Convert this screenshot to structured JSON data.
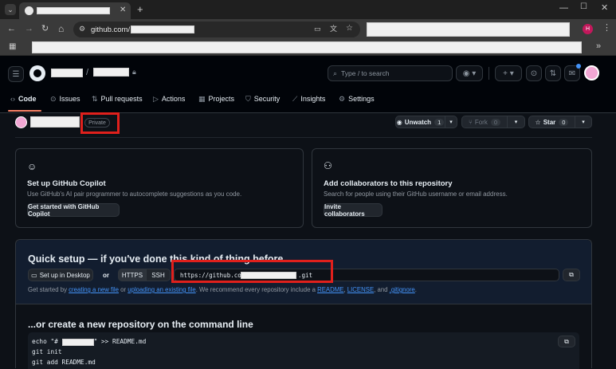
{
  "browser": {
    "url_prefix": "github.com/",
    "profile_initial": "H"
  },
  "header": {
    "search_placeholder": "Type / to search",
    "search_key": "/"
  },
  "nav": {
    "tabs": [
      {
        "label": "Code",
        "icon": "code-icon",
        "active": true
      },
      {
        "label": "Issues",
        "icon": "issue-icon"
      },
      {
        "label": "Pull requests",
        "icon": "pull-request-icon"
      },
      {
        "label": "Actions",
        "icon": "play-icon"
      },
      {
        "label": "Projects",
        "icon": "table-icon"
      },
      {
        "label": "Security",
        "icon": "shield-icon"
      },
      {
        "label": "Insights",
        "icon": "graph-icon"
      },
      {
        "label": "Settings",
        "icon": "gear-icon"
      }
    ]
  },
  "repo": {
    "visibility": "Private",
    "unwatch_label": "Unwatch",
    "watch_count": "1",
    "fork_label": "Fork",
    "fork_count": "0",
    "star_label": "Star",
    "star_count": "0"
  },
  "copilot_card": {
    "title": "Set up GitHub Copilot",
    "description": "Use GitHub's AI pair programmer to autocomplete suggestions as you code.",
    "button": "Get started with GitHub Copilot"
  },
  "collab_card": {
    "title": "Add collaborators to this repository",
    "description": "Search for people using their GitHub username or email address.",
    "button": "Invite collaborators"
  },
  "quick_setup": {
    "title": "Quick setup — if you've done this kind of thing before",
    "desktop_button": "Set up in Desktop",
    "or": "or",
    "https_label": "HTTPS",
    "ssh_label": "SSH",
    "url_start": "https://github.com/",
    "url_end": ".git",
    "help_prefix": "Get started by",
    "help_link1": "creating a new file",
    "help_or": "or",
    "help_link2": "uploading an existing file",
    "help_mid": ". We recommend every repository include a",
    "help_readme": "README",
    "help_comma": ",",
    "help_license": "LICENSE",
    "help_and": ", and",
    "help_gitignore": ".gitignore",
    "help_end": "."
  },
  "cli": {
    "title": "...or create a new repository on the command line",
    "line1_start": "echo \"#",
    "line1_end": "\" >> README.md",
    "line2": "git init",
    "line3": "git add README.md"
  }
}
